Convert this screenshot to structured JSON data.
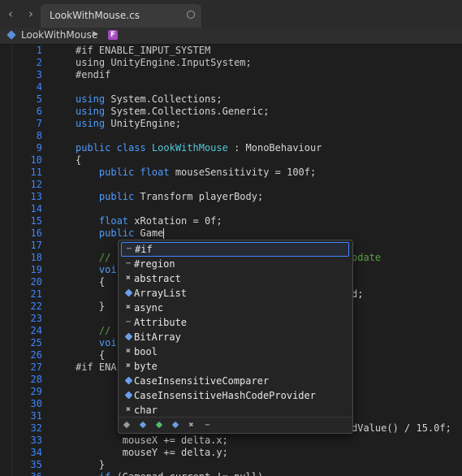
{
  "tab": {
    "filename": "LookWithMouse.cs"
  },
  "breadcrumb": {
    "class_name": "LookWithMouse",
    "member_badge": "F"
  },
  "code_lines": [
    {
      "n": "1",
      "t": "#if ENABLE_INPUT_SYSTEM"
    },
    {
      "n": "2",
      "t": "using UnityEngine.InputSystem;"
    },
    {
      "n": "3",
      "t": "#endif"
    },
    {
      "n": "4",
      "t": ""
    },
    {
      "n": "5",
      "t": "using System.Collections;"
    },
    {
      "n": "6",
      "t": "using System.Collections.Generic;"
    },
    {
      "n": "7",
      "t": "using UnityEngine;"
    },
    {
      "n": "8",
      "t": ""
    },
    {
      "n": "9",
      "t": "public class LookWithMouse : MonoBehaviour"
    },
    {
      "n": "10",
      "t": "{"
    },
    {
      "n": "11",
      "t": "    public float mouseSensitivity = 100f;"
    },
    {
      "n": "12",
      "t": ""
    },
    {
      "n": "13",
      "t": "    public Transform playerBody;"
    },
    {
      "n": "14",
      "t": ""
    },
    {
      "n": "15",
      "t": "    float xRotation = 0f;"
    },
    {
      "n": "16",
      "t": "    public Game"
    },
    {
      "n": "17",
      "t": ""
    },
    {
      "n": "18",
      "t": "    // ...pdate"
    },
    {
      "n": "19",
      "t": "    voi"
    },
    {
      "n": "20",
      "t": "    {"
    },
    {
      "n": "21",
      "t": "    ...d;"
    },
    {
      "n": "22",
      "t": "    }"
    },
    {
      "n": "23",
      "t": ""
    },
    {
      "n": "24",
      "t": "    // "
    },
    {
      "n": "25",
      "t": "    voi"
    },
    {
      "n": "26",
      "t": "    {"
    },
    {
      "n": "27",
      "t": "#if ENA"
    },
    {
      "n": "28",
      "t": ""
    },
    {
      "n": "29",
      "t": ""
    },
    {
      "n": "30",
      "t": ""
    },
    {
      "n": "31",
      "t": ""
    },
    {
      "n": "32",
      "t": "...dValue() / 15.0f;"
    },
    {
      "n": "33",
      "t": "        mouseX += delta.x;"
    },
    {
      "n": "34",
      "t": "        mouseY += delta.y;"
    },
    {
      "n": "35",
      "t": "    }"
    },
    {
      "n": "36",
      "t": "    if (Gamepad.current != null)"
    }
  ],
  "completion": {
    "items": [
      {
        "label": "#if",
        "icon": "snippet-icon",
        "selected": true
      },
      {
        "label": "#region",
        "icon": "snippet-icon"
      },
      {
        "label": "abstract",
        "icon": "keyword-icon"
      },
      {
        "label": "ArrayList",
        "icon": "class-icon"
      },
      {
        "label": "async",
        "icon": "keyword-icon"
      },
      {
        "label": "Attribute",
        "icon": "snippet-icon"
      },
      {
        "label": "BitArray",
        "icon": "class-icon"
      },
      {
        "label": "bool",
        "icon": "keyword-icon"
      },
      {
        "label": "byte",
        "icon": "keyword-icon"
      },
      {
        "label": "CaseInsensitiveComparer",
        "icon": "class-icon"
      },
      {
        "label": "CaseInsensitiveHashCodeProvider",
        "icon": "class-icon"
      },
      {
        "label": "char",
        "icon": "keyword-icon"
      }
    ],
    "filter_icons": [
      "class-filter-icon",
      "struct-filter-icon",
      "interface-filter-icon",
      "enum-filter-icon",
      "keyword-filter-icon",
      "snippet-filter-icon"
    ]
  },
  "colors": {
    "keyword": "#4f9bff",
    "type": "#4fc8d8",
    "comment": "#5a9f48",
    "line_number": "#3d86ff",
    "selection_border": "#3d86ff"
  }
}
